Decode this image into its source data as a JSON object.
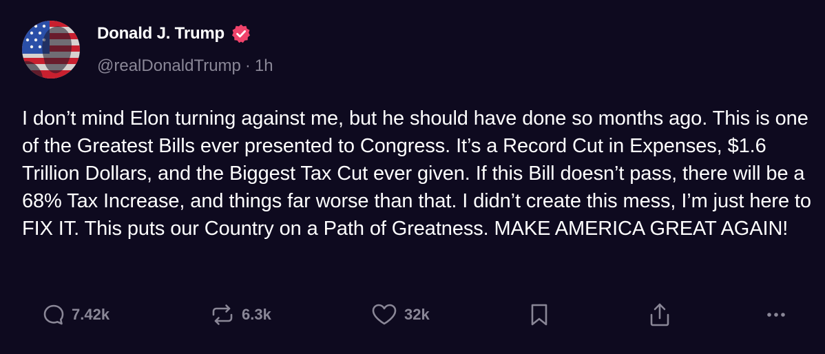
{
  "post": {
    "display_name": "Donald J. Trump",
    "handle": "@realDonaldTrump",
    "separator": "·",
    "time_ago": "1h",
    "body": "I don’t mind Elon turning against me, but he should have done so months ago. This is one of the Greatest Bills ever presented to Congress. It’s a Record Cut in Expenses, $1.6 Trillion Dollars, and the Biggest Tax Cut ever given. If this Bill doesn’t pass, there will be a 68% Tax Increase, and things far worse than that. I didn’t create this mess, I’m just here to FIX IT. This puts our Country on a Path of Greatness. MAKE AMERICA GREAT AGAIN!",
    "verified": true
  },
  "actions": {
    "reply_count": "7.42k",
    "repost_count": "6.3k",
    "like_count": "32k"
  },
  "icons": {
    "avatar": "avatar-flag-portrait",
    "verified": "verified-badge-icon",
    "reply": "reply-icon",
    "repost": "repost-icon",
    "like": "heart-icon",
    "bookmark": "bookmark-icon",
    "share": "share-icon",
    "more": "more-icon"
  },
  "colors": {
    "background": "#0e0a1f",
    "text": "#ffffff",
    "muted": "#8a8797",
    "verified_badge": "#f0436b"
  }
}
